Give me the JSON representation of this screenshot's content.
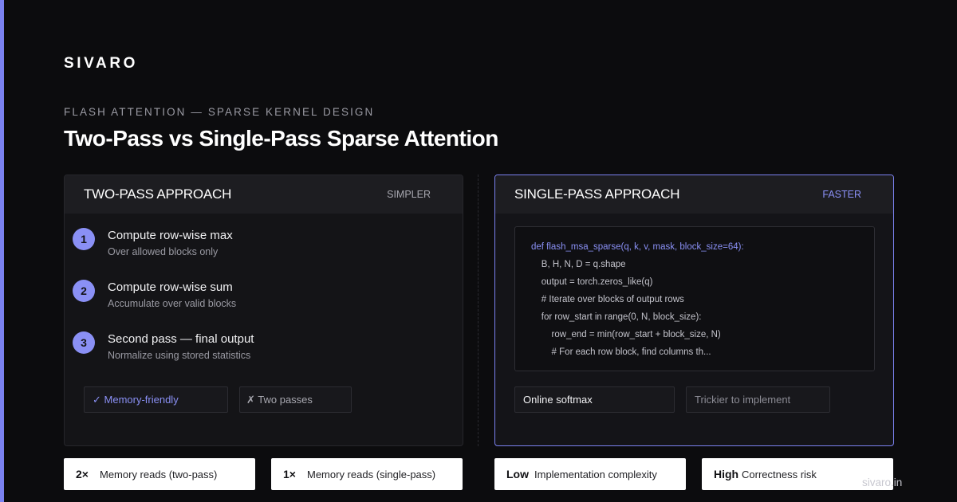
{
  "brand": "SIVARO",
  "eyebrow": "FLASH ATTENTION — SPARSE KERNEL DESIGN",
  "title": "Two-Pass vs Single-Pass Sparse Attention",
  "left_card": {
    "title": "TWO-PASS APPROACH",
    "tag": "SIMPLER",
    "steps": [
      {
        "num": "1",
        "title": "Compute row-wise max",
        "sub": "Over allowed blocks only"
      },
      {
        "num": "2",
        "title": "Compute row-wise sum",
        "sub": "Accumulate over valid blocks"
      },
      {
        "num": "3",
        "title": "Second pass — final output",
        "sub": "Normalize using stored statistics"
      }
    ],
    "chips": [
      {
        "text": "✓ Memory-friendly",
        "color": "#8a90f5"
      },
      {
        "text": "✗ Two passes",
        "color": "#a8a8b0"
      }
    ]
  },
  "right_card": {
    "title": "SINGLE-PASS APPROACH",
    "tag": "FASTER",
    "code": [
      "def flash_msa_sparse(q, k, v, mask, block_size=64):",
      "    B, H, N, D = q.shape",
      "    output = torch.zeros_like(q)",
      "    # Iterate over blocks of output rows",
      "    for row_start in range(0, N, block_size):",
      "        row_end = min(row_start + block_size, N)",
      "        # For each row block, find columns th..."
    ],
    "chips": [
      {
        "text": "Online softmax",
        "color": "#f2f2f4"
      },
      {
        "text": "Trickier to implement",
        "color": "#9a9aa3"
      }
    ]
  },
  "stats": [
    {
      "value": "2×",
      "label": "Memory reads (two-pass)"
    },
    {
      "value": "1×",
      "label": "Memory reads (single-pass)"
    },
    {
      "value": "Low",
      "label": "Implementation complexity"
    },
    {
      "value": "High",
      "label": "Correctness risk"
    }
  ],
  "footer_url": "sivaro.in",
  "colors": {
    "accent": "#7b82f0",
    "background": "#0c0c0e"
  }
}
